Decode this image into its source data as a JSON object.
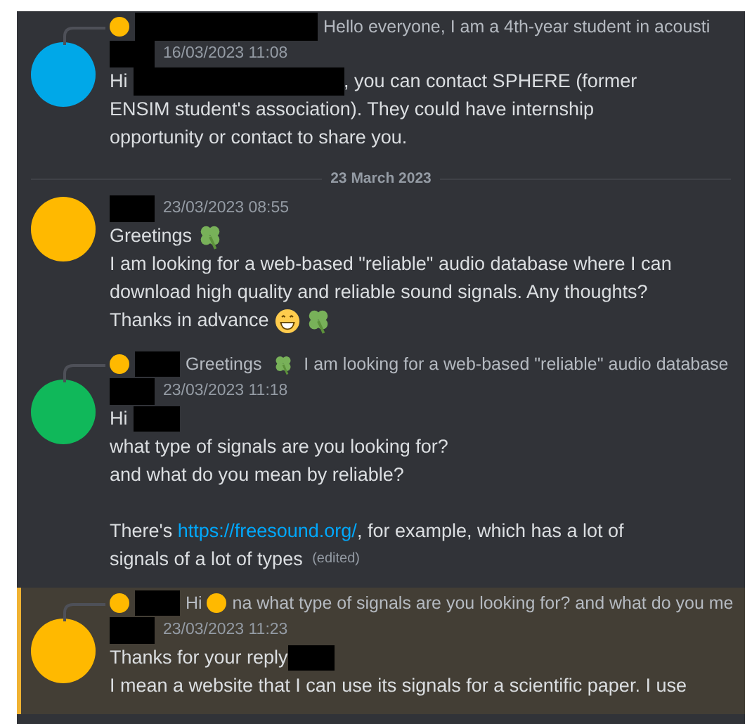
{
  "messages": [
    {
      "color": "#00a8e8",
      "highlighted": false,
      "reply": {
        "color": "#ffb900",
        "segments": [
          {
            "kind": "redacted-long"
          },
          {
            "kind": "text",
            "text": "Hello everyone, I am a 4th-year student in acousti"
          }
        ]
      },
      "timestamp": "16/03/2023 11:08",
      "paragraphs": [
        [
          [
            {
              "kind": "text",
              "text": "Hi "
            },
            {
              "kind": "redacted-long"
            },
            {
              "kind": "text",
              "text": ", you can contact SPHERE (former"
            }
          ],
          [
            {
              "kind": "text",
              "text": "ENSIM student's association). They could have internship"
            }
          ],
          [
            {
              "kind": "text",
              "text": "opportunity or contact to share you."
            }
          ]
        ]
      ]
    },
    {
      "divider": "23 March 2023",
      "color": "#ffb900",
      "highlighted": false,
      "timestamp": "23/03/2023 08:55",
      "paragraphs": [
        [
          [
            {
              "kind": "text",
              "text": "Greetings "
            },
            {
              "kind": "clover"
            }
          ],
          [
            {
              "kind": "text",
              "text": "I am looking for a web-based \"reliable\" audio database where I can"
            }
          ],
          [
            {
              "kind": "text",
              "text": "download high quality and reliable sound signals. Any thoughts?"
            }
          ],
          [
            {
              "kind": "text",
              "text": "Thanks in advance "
            },
            {
              "kind": "grin"
            },
            {
              "kind": "clover"
            }
          ]
        ]
      ]
    },
    {
      "color": "#10b85a",
      "highlighted": false,
      "reply": {
        "color": "#ffb900",
        "segments": [
          {
            "kind": "redacted"
          },
          {
            "kind": "text",
            "text": "Greetings "
          },
          {
            "kind": "clover"
          },
          {
            "kind": "text",
            "text": " I am looking for a web-based \"reliable\" audio database"
          }
        ]
      },
      "timestamp": "23/03/2023 11:18",
      "paragraphs": [
        [
          [
            {
              "kind": "text",
              "text": "Hi "
            },
            {
              "kind": "redacted"
            }
          ],
          [
            {
              "kind": "text",
              "text": "what type of signals are you looking for?"
            }
          ],
          [
            {
              "kind": "text",
              "text": "and what do you mean by reliable?"
            }
          ]
        ],
        [
          [
            {
              "kind": "text",
              "text": "There's "
            },
            {
              "kind": "link",
              "text": "https://freesound.org/"
            },
            {
              "kind": "text",
              "text": ", for example, which has a lot of"
            }
          ],
          [
            {
              "kind": "text",
              "text": "signals of a lot of types "
            },
            {
              "kind": "edited",
              "text": "(edited)"
            }
          ]
        ]
      ]
    },
    {
      "color": "#ffb900",
      "highlighted": true,
      "reply": {
        "color": "#ffb900",
        "segments": [
          {
            "kind": "redacted"
          },
          {
            "kind": "text",
            "text": "Hi "
          },
          {
            "kind": "dot"
          },
          {
            "kind": "text",
            "text": "na what type of signals are you looking for? and what do you me"
          }
        ]
      },
      "timestamp": "23/03/2023 11:23",
      "paragraphs": [
        [
          [
            {
              "kind": "text",
              "text": "Thanks for your reply"
            },
            {
              "kind": "redacted"
            }
          ],
          [
            {
              "kind": "text",
              "text": "I mean a website that I can use its signals for a scientific paper. I use"
            }
          ]
        ]
      ]
    }
  ]
}
